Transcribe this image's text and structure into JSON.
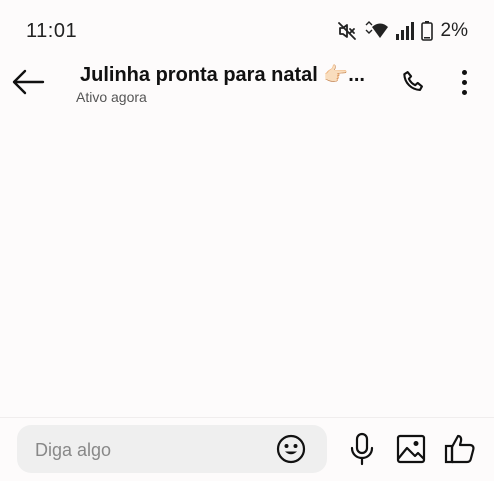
{
  "status_bar": {
    "time": "11:01",
    "battery_percent": "2%",
    "icons": [
      "mute-icon",
      "wifi-icon",
      "signal-icon",
      "battery-icon"
    ]
  },
  "chat": {
    "title": "Julinha pronta para natal 👉🏻...",
    "status": "Ativo agora"
  },
  "composer": {
    "placeholder": "Diga algo",
    "icons": [
      "emoji-icon",
      "microphone-icon",
      "image-icon",
      "thumbs-up-icon"
    ]
  },
  "colors": {
    "background": "#fdfbfb",
    "input_background": "#efefef",
    "text": "#111111",
    "secondary_text": "#555555"
  }
}
